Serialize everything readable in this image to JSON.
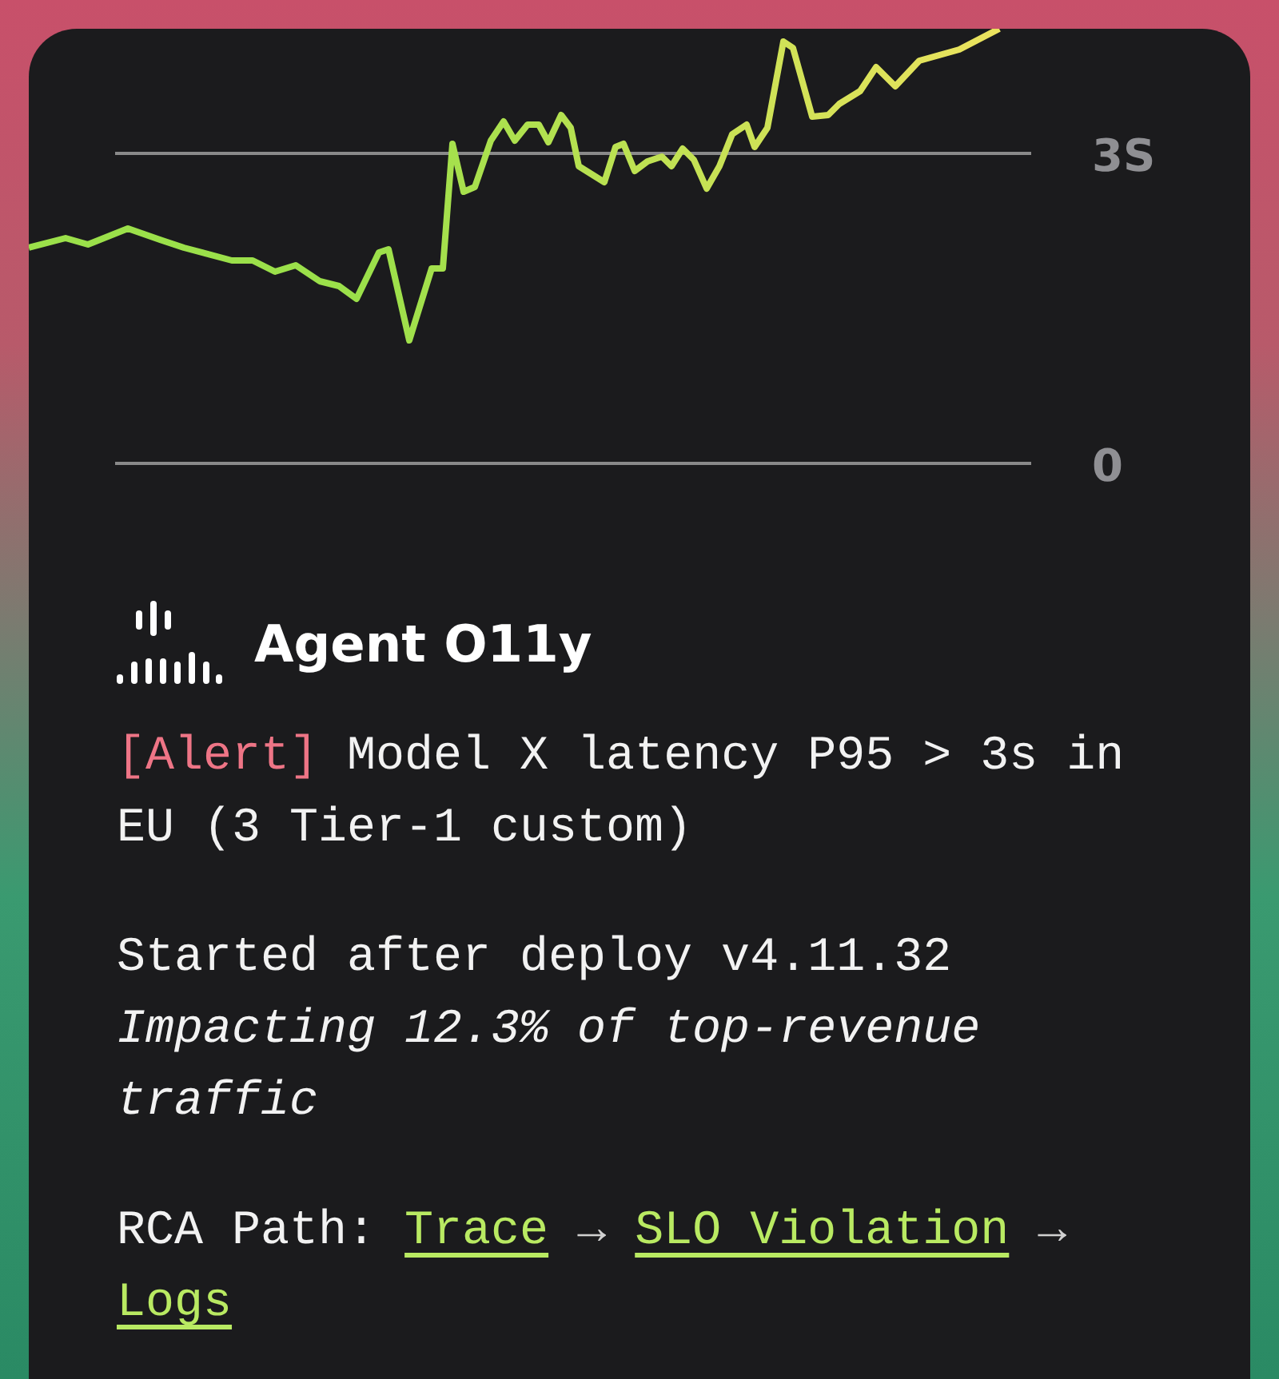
{
  "chart": {
    "gridlines": [
      {
        "label": "3S"
      },
      {
        "label": "0"
      }
    ]
  },
  "app": {
    "name": "Agent O11y"
  },
  "alert": {
    "tag": "[Alert]",
    "text": "Model X latency P95 > 3s in EU (3 Tier-1 custom)"
  },
  "details": {
    "started": "Started after deploy v4.11.32",
    "impact": "Impacting 12.3% of top-revenue traffic"
  },
  "rca": {
    "label": "RCA Path:",
    "steps": [
      {
        "label": "Trace",
        "arrow": "→"
      },
      {
        "label": "SLO Violation",
        "arrow": "→"
      },
      {
        "label": "Logs"
      }
    ]
  }
}
